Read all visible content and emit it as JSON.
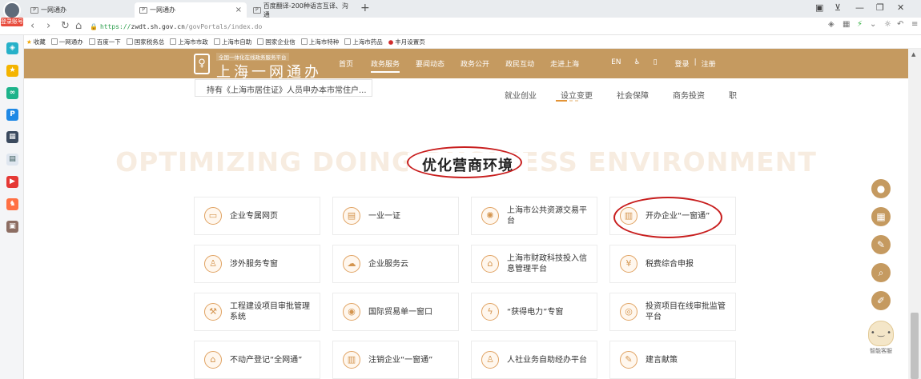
{
  "tabs": [
    {
      "title": "一网通办",
      "active": false
    },
    {
      "title": "一网通办",
      "active": true
    },
    {
      "title": "百度翻译-200种语言互译、沟通",
      "active": false
    }
  ],
  "tab_close": "×",
  "tab_new": "+",
  "login_badge": "登录账号",
  "address": {
    "protocol": "https://",
    "host": "zwdt.sh.gov.cn",
    "path": "/govPortals/index.do"
  },
  "nav_icons": [
    "back-icon",
    "forward-icon",
    "reload-icon",
    "home-icon"
  ],
  "window_controls": [
    "restore-icon",
    "pin-icon",
    "minimize-icon",
    "maximize-icon",
    "close-icon"
  ],
  "bookmarks": [
    "收藏",
    "一网通办",
    "百度一下",
    "国家税务总",
    "上海市市政",
    "上海市自助",
    "国家企业信",
    "上海市特种",
    "上海市药品",
    "丰月设置页"
  ],
  "site": {
    "subtitle": "全国一体化在线政务服务平台",
    "title": "上海一网通办",
    "nav": [
      "首页",
      "政务服务",
      "要闻动态",
      "政务公开",
      "政民互动",
      "走进上海",
      "EN",
      "登录",
      "|",
      "注册"
    ],
    "active_nav": "政务服务"
  },
  "residence_strip": "持有《上海市居住证》人员申办本市常住户...",
  "behind_tabs": [
    "就业创业",
    "设立变更",
    "社会保障",
    "商务投资",
    "职"
  ],
  "watermark": "OPTIMIZING DOING BUSINESS ENVIRONMENT",
  "section_title": "优化营商环境",
  "cards": [
    {
      "label": "企业专属网页",
      "icon": "monitor-icon"
    },
    {
      "label": "一业一证",
      "icon": "certificate-icon"
    },
    {
      "label": "上海市公共资源交易平台",
      "icon": "gear-icon"
    },
    {
      "label": "开办企业“一窗通”",
      "icon": "building-icon"
    },
    {
      "label": "涉外服务专窗",
      "icon": "person-icon"
    },
    {
      "label": "企业服务云",
      "icon": "cloud-icon"
    },
    {
      "label": "上海市财政科技投入信息管理平台",
      "icon": "house-icon"
    },
    {
      "label": "税费综合申报",
      "icon": "tax-icon"
    },
    {
      "label": "工程建设项目审批管理系统",
      "icon": "construction-icon"
    },
    {
      "label": "国际贸易单一窗口",
      "icon": "globe-icon"
    },
    {
      "label": "“获得电力”专窗",
      "icon": "power-icon"
    },
    {
      "label": "投资项目在线审批监管平台",
      "icon": "investment-icon"
    },
    {
      "label": "不动产登记“全网通”",
      "icon": "property-icon"
    },
    {
      "label": "注销企业“一窗通”",
      "icon": "building-icon"
    },
    {
      "label": "人社业务自助经办平台",
      "icon": "hr-icon"
    },
    {
      "label": "建言献策",
      "icon": "suggestion-icon"
    }
  ],
  "float_tools": [
    "user-icon",
    "calendar-icon",
    "document-icon",
    "search-icon",
    "edit-icon"
  ],
  "assistant_label": "智能客服"
}
